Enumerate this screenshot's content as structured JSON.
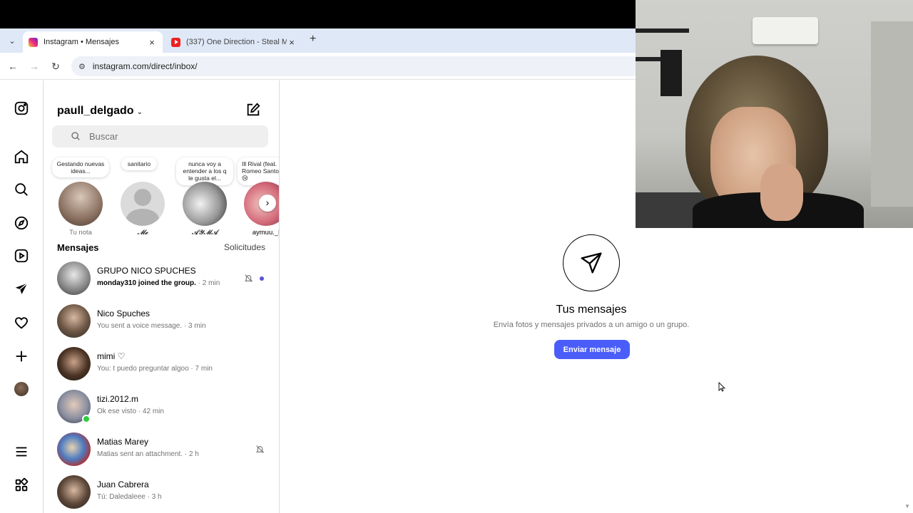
{
  "browser": {
    "tabs": [
      {
        "title": "Instagram • Mensajes",
        "favicon": "instagram-favicon",
        "active": true
      },
      {
        "title": "(337) One Direction - Steal My",
        "favicon": "youtube-favicon",
        "active": false
      }
    ],
    "new_tab_label": "+",
    "url": "instagram.com/direct/inbox/"
  },
  "sidebar": {
    "items": [
      {
        "icon": "instagram-icon"
      },
      {
        "icon": "home-icon"
      },
      {
        "icon": "search-icon"
      },
      {
        "icon": "explore-icon"
      },
      {
        "icon": "reels-icon"
      },
      {
        "icon": "messages-icon"
      },
      {
        "icon": "heart-icon"
      },
      {
        "icon": "create-icon"
      },
      {
        "icon": "profile-avatar"
      },
      {
        "icon": "menu-icon"
      },
      {
        "icon": "also-from-meta-icon"
      }
    ]
  },
  "inbox": {
    "username": "paull_delgado",
    "search_placeholder": "Buscar",
    "notes": [
      {
        "bubble": "Gestando nuevas ideas...",
        "name": "Tu nota"
      },
      {
        "bubble": "sanitario",
        "name": "𝓜𝓮"
      },
      {
        "bubble": "nunca voy a entender a los q le gusta el...",
        "name": "𝓐𝓨𝓜𝓐"
      },
      {
        "bubble": "Ill Rival (feat. Romeo Santos 😢",
        "name": "aymuu._l"
      }
    ],
    "messages_header": "Mensajes",
    "requests_label": "Solicitudes",
    "conversations": [
      {
        "name": "GRUPO NICO SPUCHES",
        "preview": "monday310 joined the group.",
        "time": "· 2 min",
        "unread": true,
        "muted": true
      },
      {
        "name": "Nico Spuches",
        "preview": "You sent a voice message.",
        "time": "· 3 min",
        "unread": false,
        "muted": false
      },
      {
        "name": "mimi ♡",
        "preview": "You: t puedo preguntar algoo",
        "time": "· 7 min",
        "unread": false,
        "muted": false
      },
      {
        "name": "tizi.2012.m",
        "preview": "Ok ese visto",
        "time": "· 42 min",
        "unread": false,
        "muted": false,
        "online": true
      },
      {
        "name": "Matias Marey",
        "preview": "Matias sent an attachment.",
        "time": "· 2 h",
        "unread": false,
        "muted": true
      },
      {
        "name": "Juan Cabrera",
        "preview": "Tú: Daledaleee",
        "time": "· 3 h",
        "unread": false,
        "muted": false
      }
    ]
  },
  "empty_state": {
    "title": "Tus mensajes",
    "subtitle": "Envía fotos y mensajes privados a un amigo o un grupo.",
    "button": "Enviar mensaje"
  },
  "colors": {
    "accent": "#4a5df9",
    "unread_dot": "#5851db",
    "online": "#2ecc40"
  }
}
